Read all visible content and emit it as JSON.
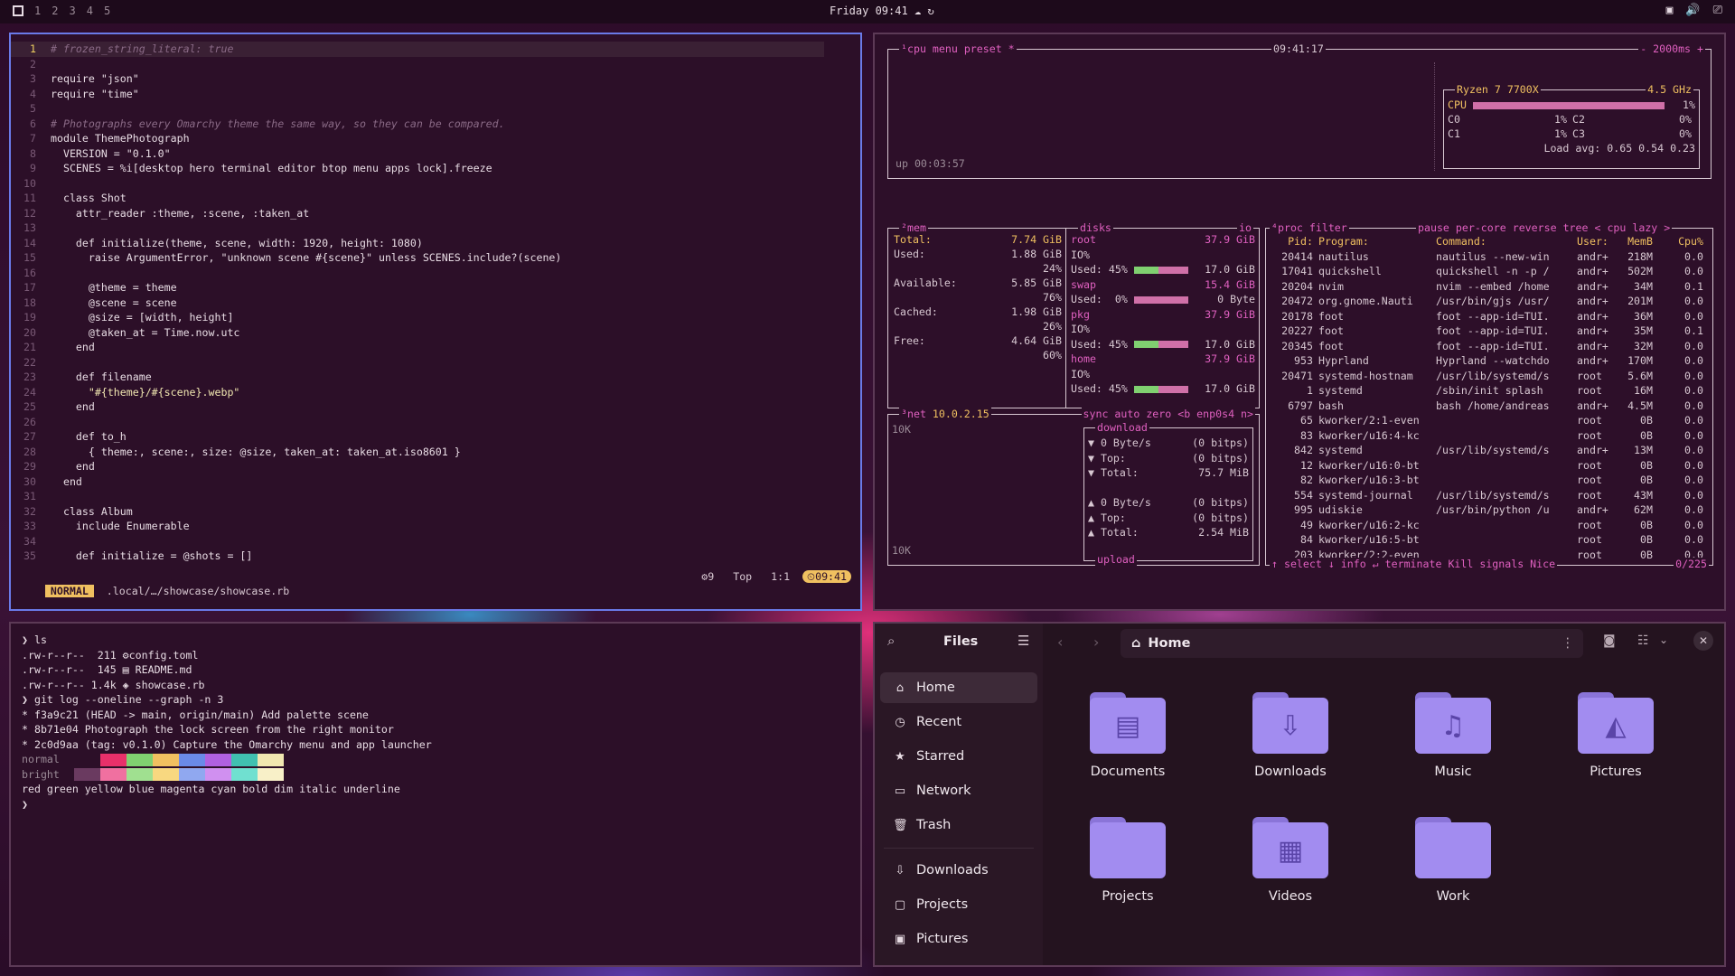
{
  "bar": {
    "workspaces": [
      "1",
      "2",
      "3",
      "4",
      "5"
    ],
    "clock": "Friday 09:41",
    "tray": [
      "▣",
      "🔊",
      "⎚"
    ]
  },
  "nvim": {
    "lines": [
      {
        "n": "1",
        "t": "# frozen_string_literal: true",
        "c": "cmt"
      },
      {
        "n": "2",
        "t": "",
        "c": "code"
      },
      {
        "n": "3",
        "t": "require \"json\"",
        "c": "code"
      },
      {
        "n": "4",
        "t": "require \"time\"",
        "c": "code"
      },
      {
        "n": "5",
        "t": "",
        "c": "code"
      },
      {
        "n": "6",
        "t": "# Photographs every Omarchy theme the same way, so they can be compared.",
        "c": "cmt"
      },
      {
        "n": "7",
        "t": "module ThemePhotograph",
        "c": "code"
      },
      {
        "n": "8",
        "t": "  VERSION = \"0.1.0\"",
        "c": "code"
      },
      {
        "n": "9",
        "t": "  SCENES = %i[desktop hero terminal editor btop menu apps lock].freeze",
        "c": "code"
      },
      {
        "n": "10",
        "t": "",
        "c": "code"
      },
      {
        "n": "11",
        "t": "  class Shot",
        "c": "code"
      },
      {
        "n": "12",
        "t": "    attr_reader :theme, :scene, :taken_at",
        "c": "code"
      },
      {
        "n": "13",
        "t": "",
        "c": "code"
      },
      {
        "n": "14",
        "t": "    def initialize(theme, scene, width: 1920, height: 1080)",
        "c": "code"
      },
      {
        "n": "15",
        "t": "      raise ArgumentError, \"unknown scene #{scene}\" unless SCENES.include?(scene)",
        "c": "code"
      },
      {
        "n": "16",
        "t": "",
        "c": "code"
      },
      {
        "n": "17",
        "t": "      @theme = theme",
        "c": "code"
      },
      {
        "n": "18",
        "t": "      @scene = scene",
        "c": "code"
      },
      {
        "n": "19",
        "t": "      @size = [width, height]",
        "c": "code"
      },
      {
        "n": "20",
        "t": "      @taken_at = Time.now.utc",
        "c": "code"
      },
      {
        "n": "21",
        "t": "    end",
        "c": "code"
      },
      {
        "n": "22",
        "t": "",
        "c": "code"
      },
      {
        "n": "23",
        "t": "    def filename",
        "c": "code"
      },
      {
        "n": "24",
        "t": "      \"#{theme}/#{scene}.webp\"",
        "c": "str"
      },
      {
        "n": "25",
        "t": "    end",
        "c": "code"
      },
      {
        "n": "26",
        "t": "",
        "c": "code"
      },
      {
        "n": "27",
        "t": "    def to_h",
        "c": "code"
      },
      {
        "n": "28",
        "t": "      { theme:, scene:, size: @size, taken_at: taken_at.iso8601 }",
        "c": "code"
      },
      {
        "n": "29",
        "t": "    end",
        "c": "code"
      },
      {
        "n": "30",
        "t": "  end",
        "c": "code"
      },
      {
        "n": "31",
        "t": "",
        "c": "code"
      },
      {
        "n": "32",
        "t": "  class Album",
        "c": "code"
      },
      {
        "n": "33",
        "t": "    include Enumerable",
        "c": "code"
      },
      {
        "n": "34",
        "t": "",
        "c": "code"
      },
      {
        "n": "35",
        "t": "    def initialize = @shots = []",
        "c": "code"
      }
    ],
    "status": {
      "mode": "NORMAL",
      "file": "  .local/…/showcase/showcase.rb",
      "lsp": "⚙9",
      "pos": "Top",
      "cursor": "1:1",
      "time": "⏲09:41"
    }
  },
  "btop": {
    "cpu": {
      "title": "¹cpu",
      "menu": "menu",
      "preset": "preset *",
      "time": "09:41:17",
      "rate": "- 2000ms +",
      "model": "Ryzen 7 7700X",
      "ghz": "4.5 GHz",
      "uptime": "up 00:03:57",
      "rows": [
        {
          "l": "CPU",
          "v": "1%"
        },
        {
          "l": "C0",
          "v": "1%"
        },
        {
          "l": "C2",
          "v": "0%"
        },
        {
          "l": "C1",
          "v": "1%"
        },
        {
          "l": "C3",
          "v": "0%"
        }
      ],
      "load": "Load avg: 0.65 0.54 0.23"
    },
    "mem": {
      "title": "²mem",
      "disks": "disks",
      "io": "io",
      "total_l": "Total:",
      "total_v": "7.74 GiB",
      "used_l": "Used:",
      "used_v": "1.88 GiB",
      "used_p": "24%",
      "avail_l": "Available:",
      "avail_v": "5.85 GiB",
      "avail_p": "76%",
      "cached_l": "Cached:",
      "cached_v": "1.98 GiB",
      "cached_p": "26%",
      "free_l": "Free:",
      "free_v": "4.64 GiB",
      "free_p": "60%",
      "disk_list": [
        {
          "name": "root",
          "size": "37.9 GiB",
          "io": "IO%",
          "used": "Used: 45%",
          "uv": "17.0 GiB"
        },
        {
          "name": "swap",
          "size": "15.4 GiB",
          "io": "",
          "used": "Used:  0%",
          "uv": "0 Byte"
        },
        {
          "name": "pkg",
          "size": "37.9 GiB",
          "io": "IO%",
          "used": "Used: 45%",
          "uv": "17.0 GiB"
        },
        {
          "name": "home",
          "size": "37.9 GiB",
          "io": "IO%",
          "used": "Used: 45%",
          "uv": "17.0 GiB"
        }
      ]
    },
    "net": {
      "title": "³net",
      "ip": "10.0.2.15",
      "sync": "sync",
      "auto": "auto",
      "zero": "zero",
      "iface": "<b enp0s4 n>",
      "scale_top": "10K",
      "scale_bot": "10K",
      "download": "download",
      "upload": "upload",
      "dl": [
        [
          "▼ 0 Byte/s",
          "(0 bitps)"
        ],
        [
          "▼ Top:",
          "(0 bitps)"
        ],
        [
          "▼ Total:",
          "75.7 MiB"
        ]
      ],
      "ul": [
        [
          "▲ 0 Byte/s",
          "(0 bitps)"
        ],
        [
          "▲ Top:",
          "(0 bitps)"
        ],
        [
          "▲ Total:",
          "2.54 MiB"
        ]
      ]
    },
    "proc": {
      "title": "⁴proc",
      "filter": "filter",
      "pause": "pause",
      "percore": "per-core",
      "reverse": "reverse",
      "tree": "tree",
      "sort": "< cpu lazy >",
      "headers": [
        "Pid:",
        "Program:",
        "Command:",
        "User:",
        "MemB",
        "Cpu%"
      ],
      "rows": [
        [
          "20414",
          "nautilus",
          "nautilus --new-win",
          "andr+",
          "218M",
          "0.0"
        ],
        [
          "17041",
          "quickshell",
          "quickshell -n -p /",
          "andr+",
          "502M",
          "0.0"
        ],
        [
          "20204",
          "nvim",
          "nvim --embed /home",
          "andr+",
          "34M",
          "0.1"
        ],
        [
          "20472",
          "org.gnome.Nauti",
          "/usr/bin/gjs /usr/",
          "andr+",
          "201M",
          "0.0"
        ],
        [
          "20178",
          "foot",
          "foot --app-id=TUI.",
          "andr+",
          "36M",
          "0.0"
        ],
        [
          "20227",
          "foot",
          "foot --app-id=TUI.",
          "andr+",
          "35M",
          "0.1"
        ],
        [
          "20345",
          "foot",
          "foot --app-id=TUI.",
          "andr+",
          "32M",
          "0.0"
        ],
        [
          "953",
          "Hyprland",
          "Hyprland --watchdo",
          "andr+",
          "170M",
          "0.0"
        ],
        [
          "20471",
          "systemd-hostnam",
          "/usr/lib/systemd/s",
          "root",
          "5.6M",
          "0.0"
        ],
        [
          "1",
          "systemd",
          "/sbin/init splash",
          "root",
          "16M",
          "0.0"
        ],
        [
          "6797",
          "bash",
          "bash /home/andreas",
          "andr+",
          "4.5M",
          "0.0"
        ],
        [
          "65",
          "kworker/2:1-even",
          "",
          "root",
          "0B",
          "0.0"
        ],
        [
          "83",
          "kworker/u16:4-kc",
          "",
          "root",
          "0B",
          "0.0"
        ],
        [
          "842",
          "systemd",
          "/usr/lib/systemd/s",
          "andr+",
          "13M",
          "0.0"
        ],
        [
          "12",
          "kworker/u16:0-bt",
          "",
          "root",
          "0B",
          "0.0"
        ],
        [
          "82",
          "kworker/u16:3-bt",
          "",
          "root",
          "0B",
          "0.0"
        ],
        [
          "554",
          "systemd-journal",
          "/usr/lib/systemd/s",
          "root",
          "43M",
          "0.0"
        ],
        [
          "995",
          "udiskie",
          "/usr/bin/python /u",
          "andr+",
          "62M",
          "0.0"
        ],
        [
          "49",
          "kworker/u16:2-kc",
          "",
          "root",
          "0B",
          "0.0"
        ],
        [
          "84",
          "kworker/u16:5-bt",
          "",
          "root",
          "0B",
          "0.0"
        ],
        [
          "203",
          "kworker/2:2-even",
          "",
          "root",
          "0B",
          "0.0"
        ]
      ],
      "footer": "↑ select ↓ info ↵ terminate Kill signals Nice",
      "count": "0/225"
    }
  },
  "term": {
    "lines": [
      {
        "t": "❯ ls",
        "c": "prompt"
      },
      {
        "t": ".rw-r--r--  211 ⚙config.toml",
        "c": "code"
      },
      {
        "t": ".rw-r--r--  145 ▤ README.md",
        "c": "code"
      },
      {
        "t": ".rw-r--r-- 1.4k ◈ showcase.rb",
        "c": "code"
      },
      {
        "t": "❯ git log --oneline --graph -n 3",
        "c": "prompt"
      },
      {
        "t": "* f3a9c21 (HEAD -> main, origin/main) Add palette scene",
        "c": "code"
      },
      {
        "t": "* 8b71e04 Photograph the lock screen from the right monitor",
        "c": "code"
      },
      {
        "t": "* 2c0d9aa (tag: v0.1.0) Capture the Omarchy menu and app launcher",
        "c": "code"
      },
      {
        "t": "normal",
        "c": "dim"
      },
      {
        "t": "bright",
        "c": "dim"
      },
      {
        "t": "red green yellow blue magenta cyan bold dim italic underline",
        "c": "code"
      },
      {
        "t": "❯",
        "c": "prompt"
      }
    ],
    "palette_normal": [
      "#2c0f28",
      "#e8306a",
      "#80d070",
      "#f0c060",
      "#6a8ae8",
      "#b060e0",
      "#40c0b0",
      "#f0e6b0"
    ],
    "palette_bright": [
      "#6a3a60",
      "#f070a0",
      "#a0e090",
      "#f8d880",
      "#90a8f0",
      "#d090f0",
      "#70e0d0",
      "#f8f0c8"
    ]
  },
  "files": {
    "title": "Files",
    "path": "Home",
    "sidebar": [
      {
        "label": "Home",
        "icon": "⌂",
        "active": true
      },
      {
        "label": "Recent",
        "icon": "◷"
      },
      {
        "label": "Starred",
        "icon": "★"
      },
      {
        "label": "Network",
        "icon": "▭"
      },
      {
        "label": "Trash",
        "icon": "🗑"
      },
      {
        "label": "Downloads",
        "icon": "⇩"
      },
      {
        "label": "Projects",
        "icon": "▢"
      },
      {
        "label": "Pictures",
        "icon": "▣"
      }
    ],
    "folders": [
      {
        "label": "Documents",
        "glyph": "▤"
      },
      {
        "label": "Downloads",
        "glyph": "⇩"
      },
      {
        "label": "Music",
        "glyph": "♫"
      },
      {
        "label": "Pictures",
        "glyph": "◭"
      },
      {
        "label": "Projects",
        "glyph": ""
      },
      {
        "label": "Videos",
        "glyph": "▦"
      },
      {
        "label": "Work",
        "glyph": ""
      }
    ]
  }
}
